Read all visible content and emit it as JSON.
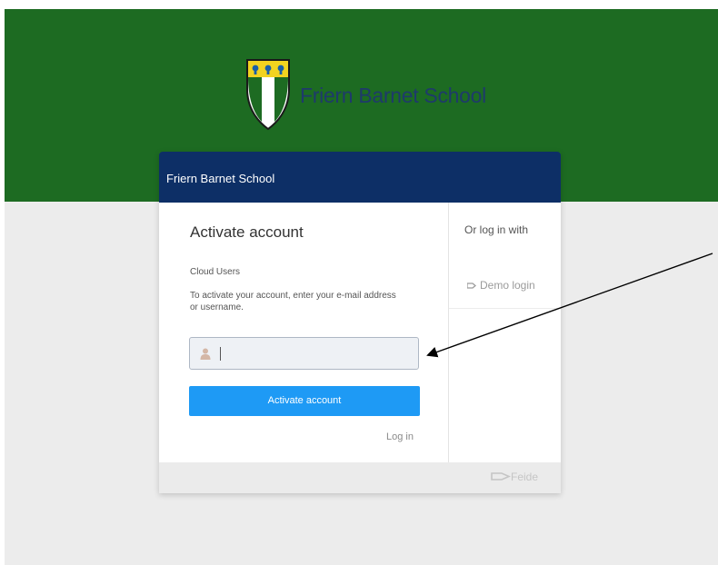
{
  "banner": {
    "school_name": "Friern Barnet School"
  },
  "card": {
    "header_title": "Friern Barnet School",
    "activate_title": "Activate account",
    "cloud_users": "Cloud Users",
    "instructions": "To activate your account, enter your e-mail address or username.",
    "input": {
      "value": "",
      "placeholder": ""
    },
    "activate_button_label": "Activate account",
    "login_link": "Log in",
    "side": {
      "or_login_with": "Or log in with",
      "demo_login": "Demo login"
    },
    "footer_brand": "Feide"
  },
  "colors": {
    "banner_green": "#1d6b22",
    "header_navy": "#0d2f66",
    "button_blue": "#1e9af5",
    "logo_text": "#1e3a6b"
  },
  "icons": [
    "school-crest-icon",
    "person-icon",
    "demo-login-icon",
    "brand-logo-icon"
  ]
}
